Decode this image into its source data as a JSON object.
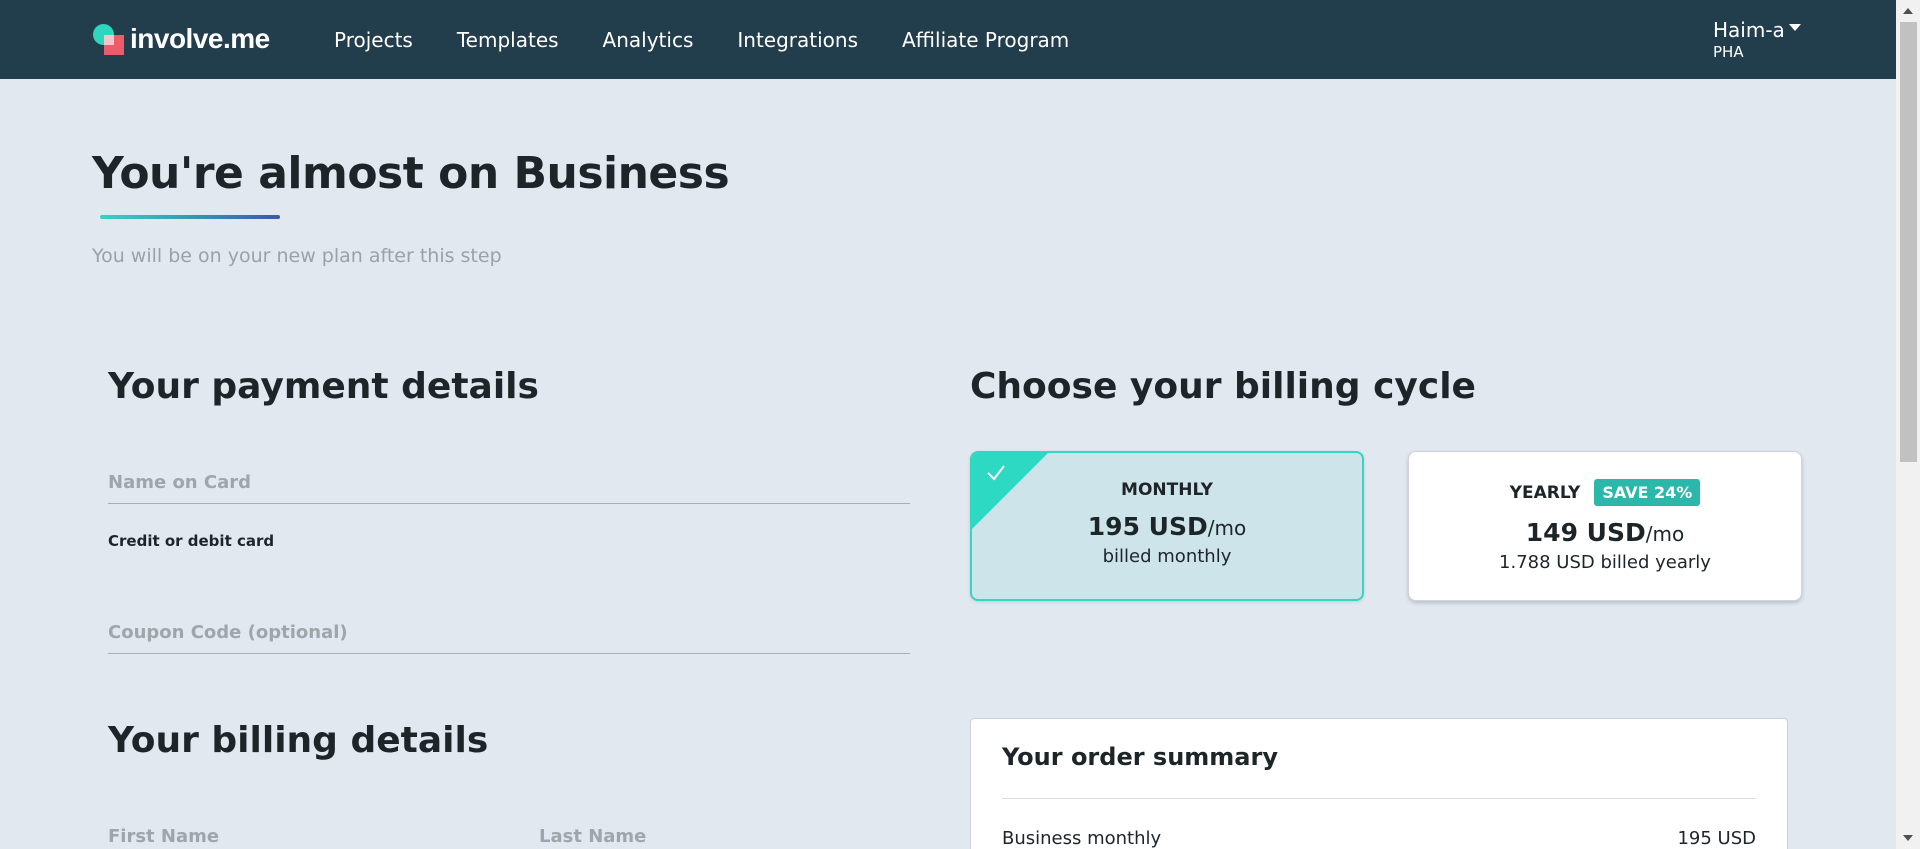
{
  "brand": {
    "name": "involve.me"
  },
  "nav": {
    "items": [
      "Projects",
      "Templates",
      "Analytics",
      "Integrations",
      "Affiliate Program"
    ]
  },
  "user": {
    "name": "Haim-a",
    "org": "PHA"
  },
  "hero": {
    "title": "You're almost on Business",
    "subtitle": "You will be on your new plan after this step"
  },
  "payment": {
    "title": "Your payment details",
    "name_on_card_placeholder": "Name on Card",
    "card_label": "Credit or debit card",
    "coupon_placeholder": "Coupon Code (optional)"
  },
  "billing_details": {
    "title": "Your billing details",
    "first_name_placeholder": "First Name",
    "last_name_placeholder": "Last Name"
  },
  "billing_cycle": {
    "title": "Choose your billing cycle",
    "monthly": {
      "name": "MONTHLY",
      "price": "195 USD",
      "unit": "/mo",
      "billed": "billed monthly",
      "selected": true
    },
    "yearly": {
      "name": "YEARLY",
      "badge": "SAVE 24%",
      "price": "149 USD",
      "unit": "/mo",
      "billed": "1.788 USD billed yearly",
      "selected": false
    }
  },
  "order_summary": {
    "title": "Your order summary",
    "items": [
      {
        "label": "Business monthly",
        "value": "195 USD"
      }
    ]
  },
  "colors": {
    "topbar": "#223d4b",
    "page_bg": "#e1e8f0",
    "accent_teal": "#2ed9c3",
    "badge": "#2bb7a9",
    "selected_plan_bg": "#cde4ea"
  },
  "icons": [
    "check-icon",
    "chevron-down-icon"
  ]
}
